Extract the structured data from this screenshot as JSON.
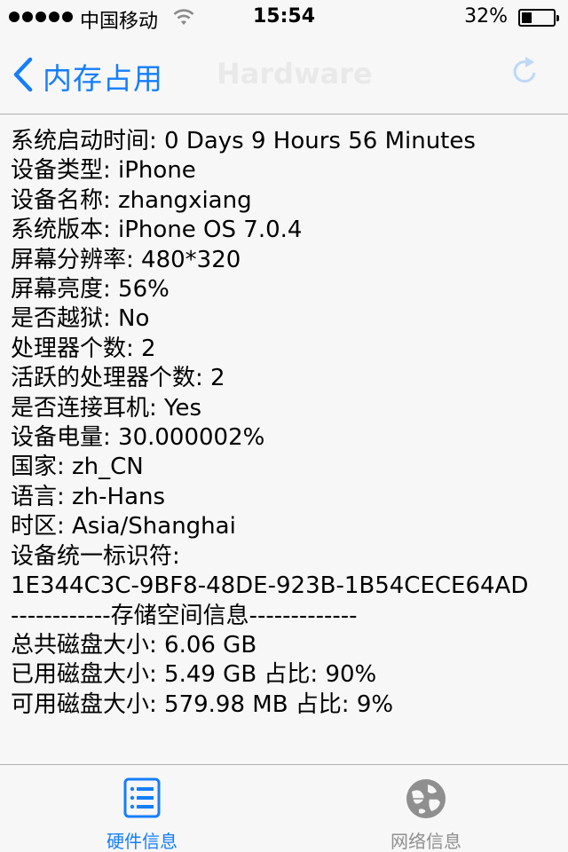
{
  "status_bar": {
    "carrier": "中国移动",
    "time": "15:54",
    "battery_percent_label": "32%",
    "battery_level": 0.32,
    "signal_bars": 5
  },
  "nav": {
    "back_label": "内存占用",
    "title": "Hardware",
    "accent_color": "#157efb"
  },
  "info": {
    "lines": [
      "系统启动时间: 0 Days 9 Hours 56 Minutes",
      "设备类型: iPhone",
      "设备名称: zhangxiang",
      "系统版本: iPhone OS 7.0.4",
      "屏幕分辨率: 480*320",
      "屏幕亮度: 56%",
      "是否越狱: No",
      "处理器个数: 2",
      "活跃的处理器个数: 2",
      "是否连接耳机: Yes",
      "设备电量: 30.000002%",
      "国家: zh_CN",
      "语言: zh-Hans",
      "时区: Asia/Shanghai",
      "设备统一标识符:",
      "1E344C3C-9BF8-48DE-923B-1B54CECE64AD",
      "------------存储空间信息-------------",
      "总共磁盘大小: 6.06 GB",
      "已用磁盘大小: 5.49 GB 占比: 90%",
      "可用磁盘大小: 579.98 MB 占比: 9%"
    ]
  },
  "tabs": [
    {
      "label": "硬件信息",
      "icon": "list-icon",
      "active": true
    },
    {
      "label": "网络信息",
      "icon": "globe-icon",
      "active": false
    }
  ]
}
